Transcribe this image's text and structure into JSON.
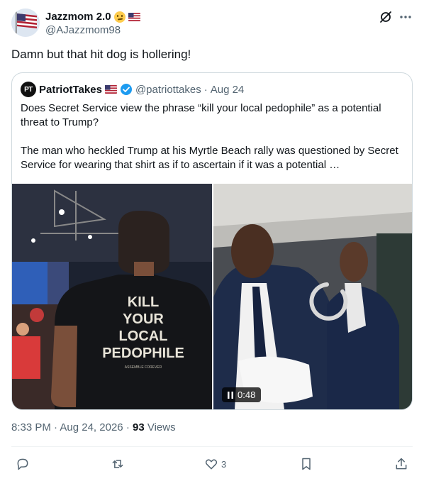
{
  "author": {
    "display_name": "Jazzmom 2.0",
    "handle": "@AJazzmom98",
    "name_emojis": [
      "confused-face-icon",
      "us-flag-icon"
    ]
  },
  "tweet": {
    "text": "Damn but that hit dog is hollering!"
  },
  "quoted": {
    "avatar_text": "PT",
    "name": "PatriotTakes",
    "handle": "@patriottakes",
    "separator": "·",
    "date": "Aug 24",
    "paragraph1": "Does Secret Service view the phrase “kill your local pedophile” as a potential threat to Trump?",
    "paragraph2": "The man who heckled Trump at his Myrtle Beach rally was questioned by Secret Service for wearing that shirt as if to ascertain if it was a potential …",
    "shirt_text": [
      "KILL",
      "YOUR",
      "LOCAL",
      "PEDOPHILE"
    ],
    "shirt_small": "ASSEMBLE FOREVER",
    "video_duration": "0:48"
  },
  "meta": {
    "time": "8:33 PM",
    "sep1": "·",
    "date": "Aug 24, 2026",
    "sep2": "·",
    "views_count": "93",
    "views_label": "Views"
  },
  "actions": {
    "reply_count": "",
    "repost_count": "",
    "like_count": "3"
  },
  "colors": {
    "text": "#0f1419",
    "muted": "#536471",
    "border": "#cfd9de",
    "verified": "#1d9bf0"
  }
}
